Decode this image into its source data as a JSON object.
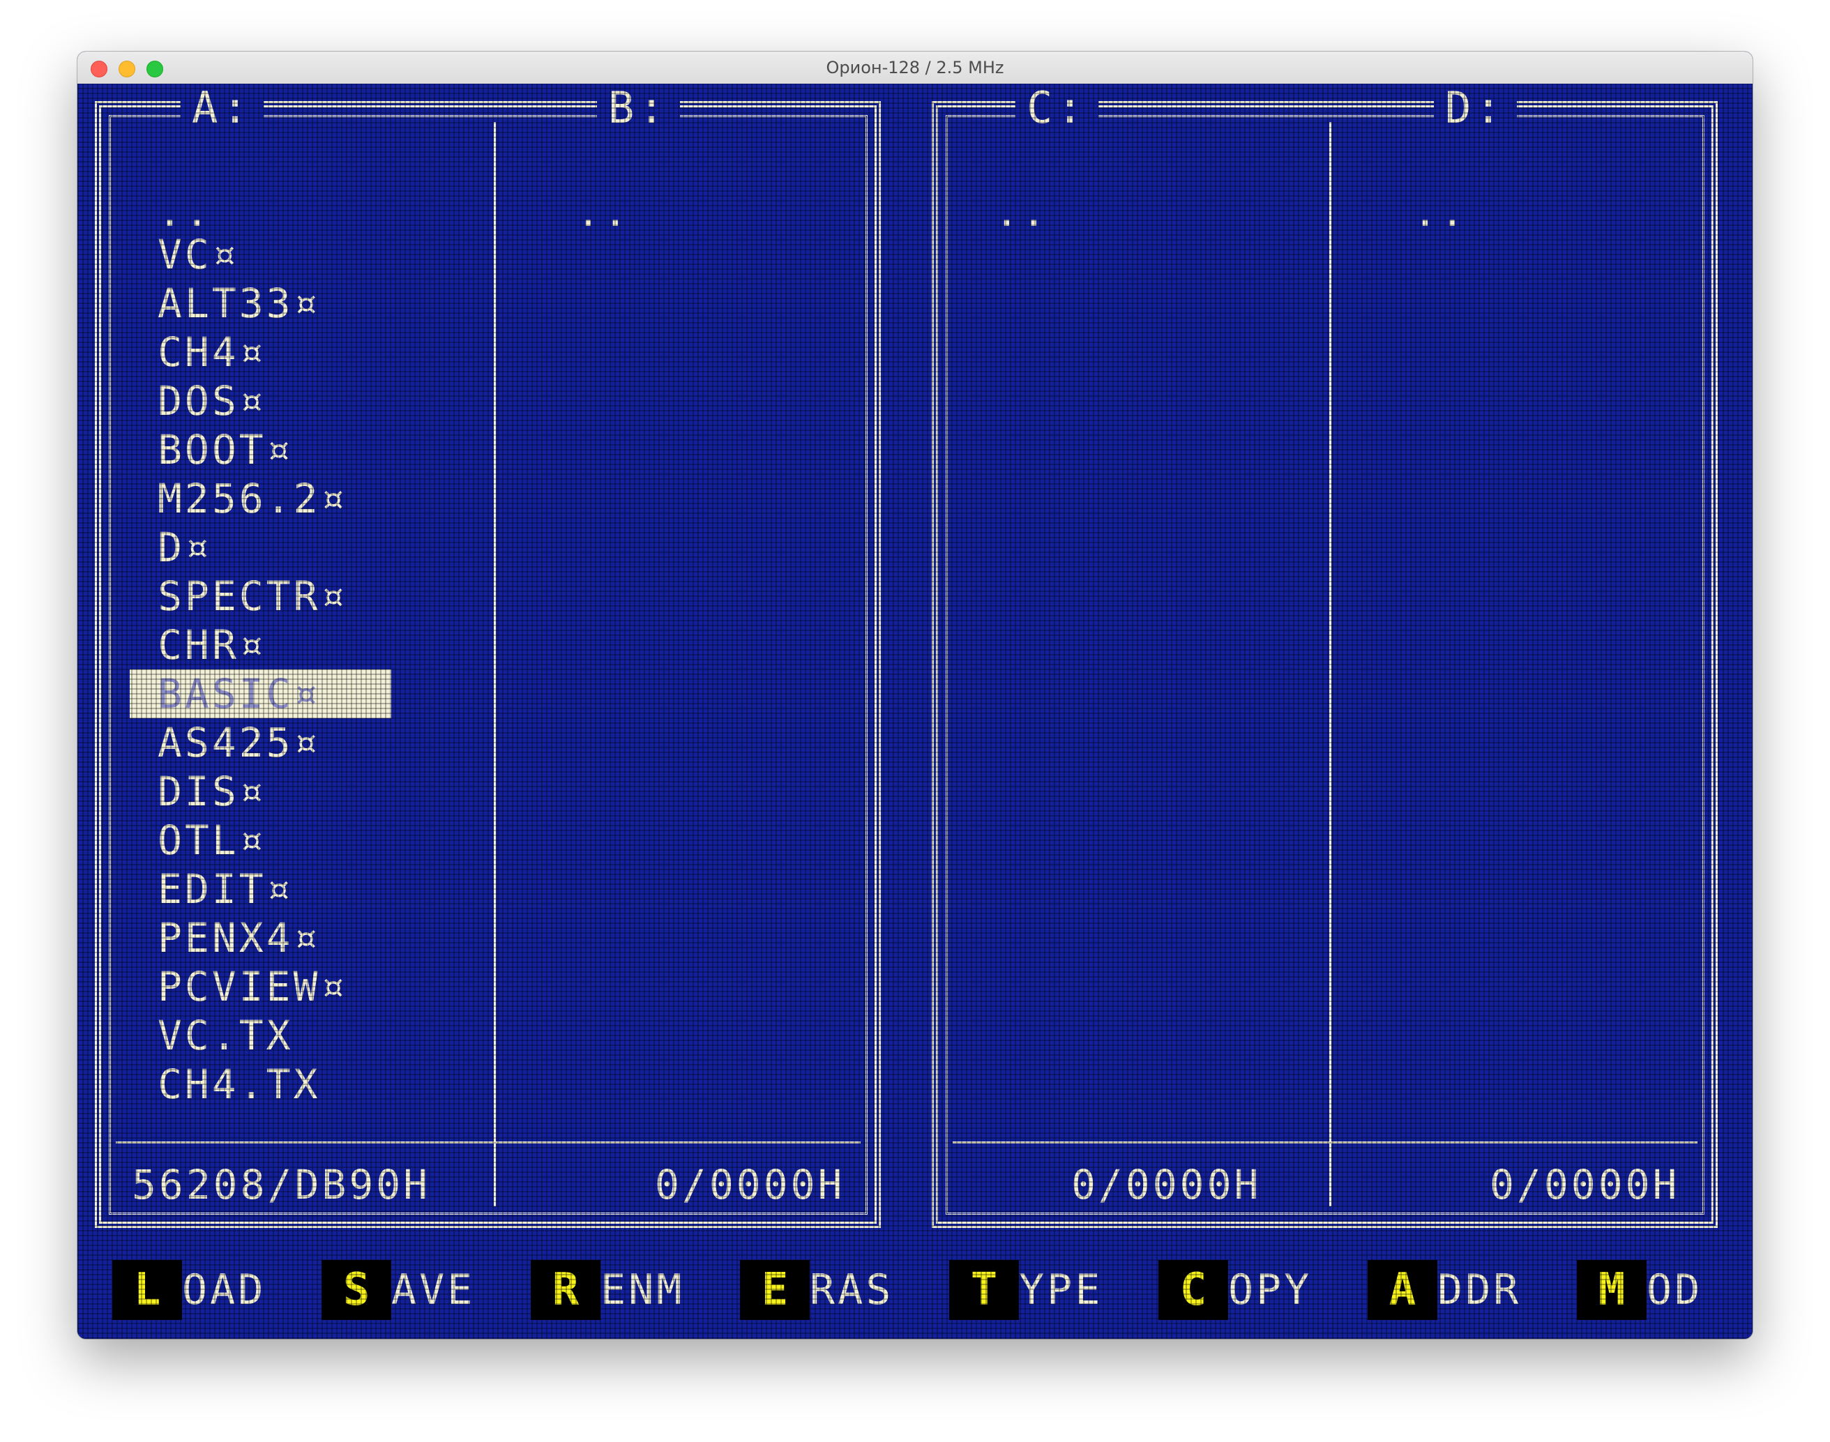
{
  "window": {
    "title": "Орион-128 / 2.5 MHz"
  },
  "left_panel": {
    "drive_a": "A:",
    "drive_b": "B:",
    "dotdot_a": "..",
    "dotdot_b": "..",
    "files": [
      "VC¤",
      "ALT33¤",
      "CH4¤",
      "DOS¤",
      "BOOT¤",
      "M256.2¤",
      "D¤",
      "SPECTR¤",
      "CHR¤",
      "BASIC¤",
      "AS425¤",
      "DIS¤",
      "OTL¤",
      "EDIT¤",
      "PENX4¤",
      "PCVIEW¤",
      "VC.TX",
      "CH4.TX"
    ],
    "selected_index": 9,
    "status_a": "56208/DB90H",
    "status_b": "0/0000H"
  },
  "right_panel": {
    "drive_c": "C:",
    "drive_d": "D:",
    "dotdot_c": "..",
    "dotdot_d": "..",
    "status_c": "0/0000H",
    "status_d": "0/0000H"
  },
  "fkeys": [
    {
      "key": "L",
      "rest": "OAD"
    },
    {
      "key": "S",
      "rest": "AVE"
    },
    {
      "key": "R",
      "rest": "ENM"
    },
    {
      "key": "E",
      "rest": "RAS"
    },
    {
      "key": "T",
      "rest": "YPE"
    },
    {
      "key": "C",
      "rest": "OPY"
    },
    {
      "key": "A",
      "rest": "DDR"
    },
    {
      "key": "M",
      "rest": "OD"
    }
  ]
}
